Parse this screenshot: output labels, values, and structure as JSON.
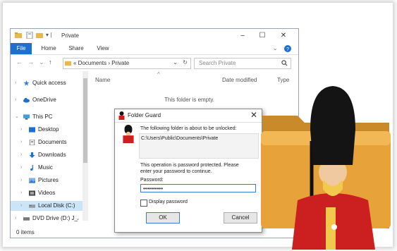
{
  "explorer": {
    "title": "Private",
    "ribbon_tabs": [
      "File",
      "Home",
      "Share",
      "View"
    ],
    "breadcrumb": [
      "Documents",
      "Private"
    ],
    "search_placeholder": "Search Private",
    "columns": [
      "Name",
      "Date modified",
      "Type"
    ],
    "empty_message": "This folder is empty.",
    "status": "0 items",
    "nav_items": [
      {
        "label": "Quick access",
        "icon": "star-icon"
      },
      {
        "label": "OneDrive",
        "icon": "cloud-icon"
      },
      {
        "label": "This PC",
        "icon": "computer-icon"
      },
      {
        "label": "Desktop",
        "icon": "desktop-icon"
      },
      {
        "label": "Documents",
        "icon": "documents-icon"
      },
      {
        "label": "Downloads",
        "icon": "downloads-icon"
      },
      {
        "label": "Music",
        "icon": "music-icon"
      },
      {
        "label": "Pictures",
        "icon": "pictures-icon"
      },
      {
        "label": "Videos",
        "icon": "videos-icon"
      },
      {
        "label": "Local Disk (C:)",
        "icon": "drive-icon"
      },
      {
        "label": "DVD Drive (D:) J_",
        "icon": "dvd-icon"
      }
    ]
  },
  "dialog": {
    "title": "Folder Guard",
    "message": "The following folder is about to be unlocked:",
    "folder_path": "C:\\Users\\Public\\Documents\\Private",
    "note_line1": "This operation is password protected.  Please",
    "note_line2": "enter your password to continue.",
    "password_label": "Password:",
    "password_value": "••••••••••",
    "display_password_label": "Display password",
    "ok_label": "OK",
    "cancel_label": "Cancel"
  },
  "colors": {
    "accent": "#1e6fd0",
    "guard_tunic": "#cc1f1f",
    "guard_hat": "#141414",
    "folder": "#e8a23a"
  }
}
